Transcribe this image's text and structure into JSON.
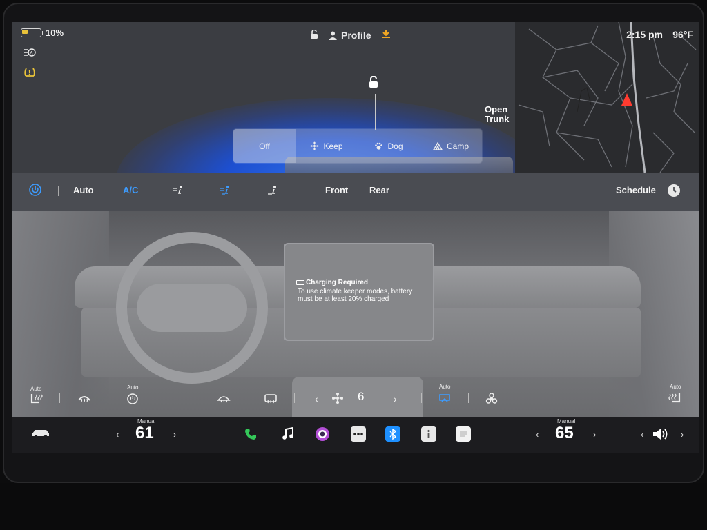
{
  "status": {
    "battery_percent": "10%",
    "battery_level": 0.1,
    "profile_label": "Profile",
    "time": "2:15 pm",
    "temperature": "96°F"
  },
  "car_view": {
    "trunk_label_line1": "Open",
    "trunk_label_line2": "Trunk",
    "keeper_modes": [
      {
        "label": "Off",
        "icon": "none",
        "selected": true
      },
      {
        "label": "Keep",
        "icon": "fan-icon"
      },
      {
        "label": "Dog",
        "icon": "paw-icon"
      },
      {
        "label": "Camp",
        "icon": "tent-icon"
      }
    ]
  },
  "climate_bar": {
    "auto_label": "Auto",
    "ac_label": "A/C",
    "front_label": "Front",
    "rear_label": "Rear",
    "schedule_label": "Schedule"
  },
  "center_message": {
    "title": "Charging Required",
    "body": "To use climate keeper modes, battery must be at least 20% charged"
  },
  "seat_row": {
    "auto_left_seat": "Auto",
    "auto_left_heat": "Auto",
    "auto_recirc": "Auto",
    "auto_right_seat": "Auto",
    "fan_speed": "6"
  },
  "dock": {
    "left_mode": "Manual",
    "left_temp": "61",
    "right_mode": "Manual",
    "right_temp": "65"
  },
  "colors": {
    "accent_blue": "#3d9cff",
    "glow_blue": "#2f6ee8",
    "warning_yellow": "#e8c23a",
    "nav_red": "#ff3b30",
    "download_orange": "#f0a623"
  }
}
